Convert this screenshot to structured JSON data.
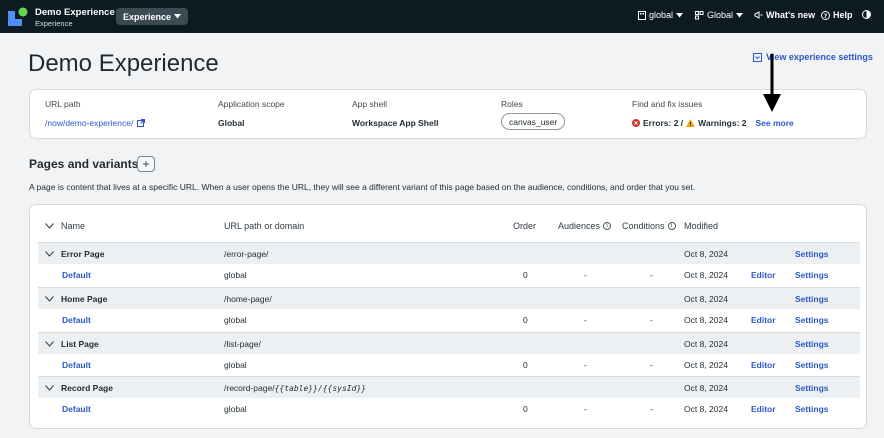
{
  "topbar": {
    "app_name": "Demo Experience",
    "app_subtitle": "Experience",
    "experience_menu": "Experience",
    "scope_global": "global",
    "app_global": "Global",
    "whats_new": "What's new",
    "help": "Help"
  },
  "header": {
    "title": "Demo Experience",
    "view_settings": "View experience settings"
  },
  "summary": {
    "url_path_label": "URL path",
    "url_path": "/now/demo-experience/",
    "app_scope_label": "Application scope",
    "app_scope": "Global",
    "app_shell_label": "App shell",
    "app_shell": "Workspace App Shell",
    "roles_label": "Roles",
    "role": "canvas_user",
    "issues_label": "Find and fix issues",
    "errors": "Errors: 2 /",
    "warnings": "Warnings: 2",
    "see_more": "See more"
  },
  "pages": {
    "title": "Pages and variants",
    "add": "+",
    "description": "A page is content that lives at a specific URL. When a user opens the URL, they will see a different variant of this page based on the audience, conditions, and order that you set.",
    "columns": {
      "name": "Name",
      "url": "URL path or domain",
      "order": "Order",
      "audiences": "Audiences",
      "conditions": "Conditions",
      "modified": "Modified"
    },
    "rows": [
      {
        "name": "Error Page",
        "url": "/error-page/",
        "modified": "Oct 8, 2024",
        "settings": "Settings",
        "variant": {
          "name": "Default",
          "url": "global",
          "order": "0",
          "audiences": "-",
          "conditions": "-",
          "modified": "Oct 8, 2024",
          "editor": "Editor",
          "settings": "Settings"
        }
      },
      {
        "name": "Home Page",
        "url": "/home-page/",
        "modified": "Oct 8, 2024",
        "settings": "Settings",
        "variant": {
          "name": "Default",
          "url": "global",
          "order": "0",
          "audiences": "-",
          "conditions": "-",
          "modified": "Oct 8, 2024",
          "editor": "Editor",
          "settings": "Settings"
        }
      },
      {
        "name": "List Page",
        "url": "/list-page/",
        "modified": "Oct 8, 2024",
        "settings": "Settings",
        "variant": {
          "name": "Default",
          "url": "global",
          "order": "0",
          "audiences": "-",
          "conditions": "-",
          "modified": "Oct 8, 2024",
          "editor": "Editor",
          "settings": "Settings"
        }
      },
      {
        "name": "Record Page",
        "url_prefix": "/record-page/",
        "url_mono": "{{table}}/{{sysId}}",
        "modified": "Oct 8, 2024",
        "settings": "Settings",
        "variant": {
          "name": "Default",
          "url": "global",
          "order": "0",
          "audiences": "-",
          "conditions": "-",
          "modified": "Oct 8, 2024",
          "editor": "Editor",
          "settings": "Settings"
        }
      }
    ]
  },
  "colors": {
    "topbar": "#0e1a22",
    "link": "#2c58c7",
    "error": "#d93025",
    "warning": "#f2a900"
  },
  "icons": [
    "logo-icon",
    "chevron-down-icon",
    "building-icon",
    "app-icon",
    "megaphone-icon",
    "help-icon",
    "contrast-icon",
    "external-link-icon",
    "error-icon",
    "warning-icon",
    "settings-box-icon",
    "info-icon",
    "arrow-down-annotation"
  ]
}
